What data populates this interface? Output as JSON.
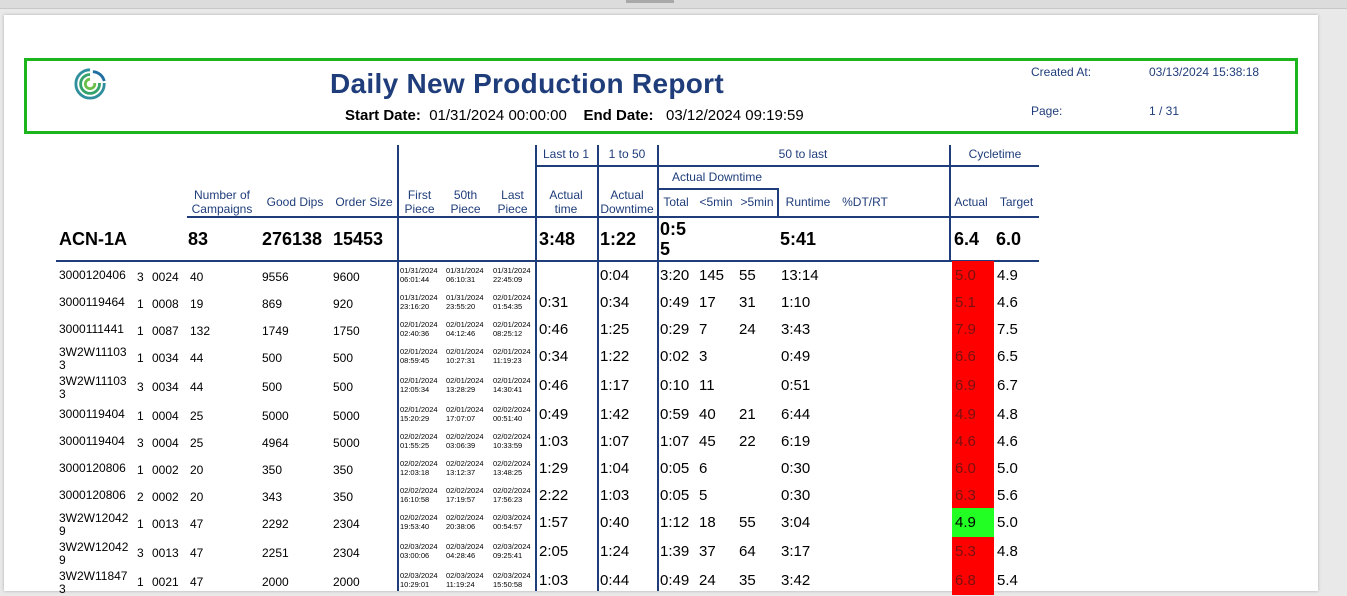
{
  "report": {
    "title": "Daily New Production Report",
    "start_label": "Start Date:",
    "start_value": "01/31/2024 00:00:00",
    "end_label": "End Date:",
    "end_value": "03/12/2024 09:19:59",
    "created_label": "Created At:",
    "created_value": "03/13/2024 15:38:18",
    "page_label": "Page:",
    "page_value": "1 / 31"
  },
  "headers": {
    "number_of_campaigns": [
      "Number of",
      "Campaigns"
    ],
    "good_dips": "Good Dips",
    "order_size": "Order Size",
    "first_piece": [
      "First",
      "Piece"
    ],
    "fiftieth_piece": [
      "50th",
      "Piece"
    ],
    "last_piece": [
      "Last",
      "Piece"
    ],
    "last_to_1": "Last to 1",
    "one_to_50": "1 to 50",
    "fifty_to_last": "50 to last",
    "cycletime": "Cycletime",
    "actual_time": [
      "Actual",
      "time"
    ],
    "actual_downtime_col": [
      "Actual",
      "Downtime"
    ],
    "actual_downtime_group": "Actual Downtime",
    "total": "Total",
    "lt5": "<5min",
    "gt5": ">5min",
    "runtime": "Runtime",
    "dt_rt": "%DT/RT",
    "actual": "Actual",
    "target": "Target"
  },
  "summary": {
    "machine": "ACN-1A",
    "campaigns": "83",
    "good_dips": "276138",
    "order_size": "15453",
    "actual_time": "3:48",
    "downtime": "1:22",
    "total_line1": "0:5",
    "total_line2": "5",
    "runtime": "5:41",
    "ct_actual": "6.4",
    "ct_target": "6.0"
  },
  "colors": {
    "red": "#ff0000",
    "green": "#22ff22",
    "header_text": "#1f3d7a",
    "frame": "#1db51d"
  },
  "rows": [
    {
      "order": "3000120406",
      "order2": "",
      "ext": "3",
      "camp": "0024",
      "n": "40",
      "good": "9556",
      "size": "9600",
      "first": [
        "01/31/2024",
        "06:01:44"
      ],
      "fifty": [
        "01/31/2024",
        "06:10:31"
      ],
      "last": [
        "01/31/2024",
        "22:45:09"
      ],
      "actual_time": "",
      "downtime": "0:04",
      "total": "3:20",
      "lt5": "145",
      "gt5": "55",
      "runtime": "13:14",
      "ct_actual": "5.0",
      "ct_target": "4.9",
      "ct_color": "red"
    },
    {
      "order": "3000119464",
      "order2": "",
      "ext": "1",
      "camp": "0008",
      "n": "19",
      "good": "869",
      "size": "920",
      "first": [
        "01/31/2024",
        "23:16:20"
      ],
      "fifty": [
        "01/31/2024",
        "23:55:20"
      ],
      "last": [
        "02/01/2024",
        "01:54:35"
      ],
      "actual_time": "0:31",
      "downtime": "0:34",
      "total": "0:49",
      "lt5": "17",
      "gt5": "31",
      "runtime": "1:10",
      "ct_actual": "5.1",
      "ct_target": "4.6",
      "ct_color": "red"
    },
    {
      "order": "3000111441",
      "order2": "",
      "ext": "1",
      "camp": "0087",
      "n": "132",
      "good": "1749",
      "size": "1750",
      "first": [
        "02/01/2024",
        "02:40:36"
      ],
      "fifty": [
        "02/01/2024",
        "04:12:46"
      ],
      "last": [
        "02/01/2024",
        "08:25:12"
      ],
      "actual_time": "0:46",
      "downtime": "1:25",
      "total": "0:29",
      "lt5": "7",
      "gt5": "24",
      "runtime": "3:43",
      "ct_actual": "7.9",
      "ct_target": "7.5",
      "ct_color": "red"
    },
    {
      "order": "3W2W11103",
      "order2": "3",
      "ext": "1",
      "camp": "0034",
      "n": "44",
      "good": "500",
      "size": "500",
      "first": [
        "02/01/2024",
        "08:59:45"
      ],
      "fifty": [
        "02/01/2024",
        "10:27:31"
      ],
      "last": [
        "02/01/2024",
        "11:19:23"
      ],
      "actual_time": "0:34",
      "downtime": "1:22",
      "total": "0:02",
      "lt5": "3",
      "gt5": "",
      "runtime": "0:49",
      "ct_actual": "6.6",
      "ct_target": "6.5",
      "ct_color": "red"
    },
    {
      "order": "3W2W11103",
      "order2": "3",
      "ext": "3",
      "camp": "0034",
      "n": "44",
      "good": "500",
      "size": "500",
      "first": [
        "02/01/2024",
        "12:05:34"
      ],
      "fifty": [
        "02/01/2024",
        "13:28:29"
      ],
      "last": [
        "02/01/2024",
        "14:30:41"
      ],
      "actual_time": "0:46",
      "downtime": "1:17",
      "total": "0:10",
      "lt5": "11",
      "gt5": "",
      "runtime": "0:51",
      "ct_actual": "6.9",
      "ct_target": "6.7",
      "ct_color": "red"
    },
    {
      "order": "3000119404",
      "order2": "",
      "ext": "1",
      "camp": "0004",
      "n": "25",
      "good": "5000",
      "size": "5000",
      "first": [
        "02/01/2024",
        "15:20:29"
      ],
      "fifty": [
        "02/01/2024",
        "17:07:07"
      ],
      "last": [
        "02/02/2024",
        "00:51:40"
      ],
      "actual_time": "0:49",
      "downtime": "1:42",
      "total": "0:59",
      "lt5": "40",
      "gt5": "21",
      "runtime": "6:44",
      "ct_actual": "4.9",
      "ct_target": "4.8",
      "ct_color": "red"
    },
    {
      "order": "3000119404",
      "order2": "",
      "ext": "3",
      "camp": "0004",
      "n": "25",
      "good": "4964",
      "size": "5000",
      "first": [
        "02/02/2024",
        "01:55:25"
      ],
      "fifty": [
        "02/02/2024",
        "03:06:39"
      ],
      "last": [
        "02/02/2024",
        "10:33:59"
      ],
      "actual_time": "1:03",
      "downtime": "1:07",
      "total": "1:07",
      "lt5": "45",
      "gt5": "22",
      "runtime": "6:19",
      "ct_actual": "4.6",
      "ct_target": "4.6",
      "ct_color": "red"
    },
    {
      "order": "3000120806",
      "order2": "",
      "ext": "1",
      "camp": "0002",
      "n": "20",
      "good": "350",
      "size": "350",
      "first": [
        "02/02/2024",
        "12:03:18"
      ],
      "fifty": [
        "02/02/2024",
        "13:12:37"
      ],
      "last": [
        "02/02/2024",
        "13:48:25"
      ],
      "actual_time": "1:29",
      "downtime": "1:04",
      "total": "0:05",
      "lt5": "6",
      "gt5": "",
      "runtime": "0:30",
      "ct_actual": "6.0",
      "ct_target": "5.0",
      "ct_color": "red"
    },
    {
      "order": "3000120806",
      "order2": "",
      "ext": "2",
      "camp": "0002",
      "n": "20",
      "good": "343",
      "size": "350",
      "first": [
        "02/02/2024",
        "16:10:58"
      ],
      "fifty": [
        "02/02/2024",
        "17:19:57"
      ],
      "last": [
        "02/02/2024",
        "17:56:23"
      ],
      "actual_time": "2:22",
      "downtime": "1:03",
      "total": "0:05",
      "lt5": "5",
      "gt5": "",
      "runtime": "0:30",
      "ct_actual": "6.3",
      "ct_target": "5.6",
      "ct_color": "red"
    },
    {
      "order": "3W2W12042",
      "order2": "9",
      "ext": "1",
      "camp": "0013",
      "n": "47",
      "good": "2292",
      "size": "2304",
      "first": [
        "02/02/2024",
        "19:53:40"
      ],
      "fifty": [
        "02/02/2024",
        "20:38:06"
      ],
      "last": [
        "02/03/2024",
        "00:54:57"
      ],
      "actual_time": "1:57",
      "downtime": "0:40",
      "total": "1:12",
      "lt5": "18",
      "gt5": "55",
      "runtime": "3:04",
      "ct_actual": "4.9",
      "ct_target": "5.0",
      "ct_color": "green"
    },
    {
      "order": "3W2W12042",
      "order2": "9",
      "ext": "3",
      "camp": "0013",
      "n": "47",
      "good": "2251",
      "size": "2304",
      "first": [
        "02/03/2024",
        "03:00:06"
      ],
      "fifty": [
        "02/03/2024",
        "04:28:46"
      ],
      "last": [
        "02/03/2024",
        "09:25:41"
      ],
      "actual_time": "2:05",
      "downtime": "1:24",
      "total": "1:39",
      "lt5": "37",
      "gt5": "64",
      "runtime": "3:17",
      "ct_actual": "5.3",
      "ct_target": "4.8",
      "ct_color": "red"
    },
    {
      "order": "3W2W11847",
      "order2": "3",
      "ext": "1",
      "camp": "0021",
      "n": "47",
      "good": "2000",
      "size": "2000",
      "first": [
        "02/03/2024",
        "10:29:01"
      ],
      "fifty": [
        "02/03/2024",
        "11:19:24"
      ],
      "last": [
        "02/03/2024",
        "15:50:58"
      ],
      "actual_time": "1:03",
      "downtime": "0:44",
      "total": "0:49",
      "lt5": "24",
      "gt5": "35",
      "runtime": "3:42",
      "ct_actual": "6.8",
      "ct_target": "5.4",
      "ct_color": "red"
    }
  ]
}
